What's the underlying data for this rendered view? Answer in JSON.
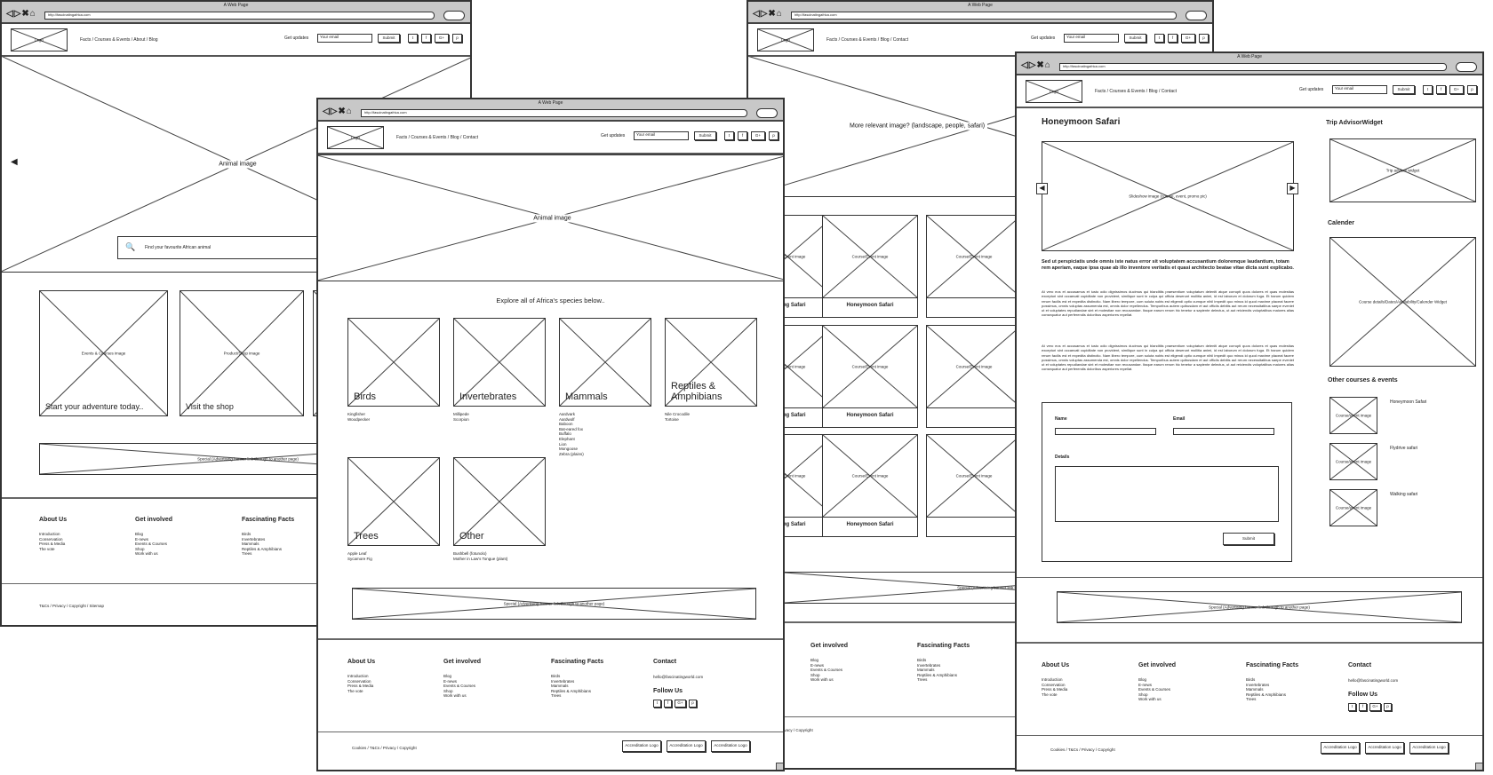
{
  "browser": {
    "title": "A Web Page",
    "url": "http://fascinatingafrica.com",
    "get_updates": "Get updates",
    "email_placeholder": "Your email",
    "submit": "Submit",
    "logo": "Logo",
    "social": [
      "t",
      "f",
      "G+",
      "p"
    ]
  },
  "footer": {
    "about": {
      "heading": "About Us",
      "items": [
        "Introduction",
        "Conservation",
        "Press & Media",
        "The vote"
      ]
    },
    "involved": {
      "heading": "Get involved",
      "items": [
        "Blog",
        "E-news",
        "Events & Courses",
        "Shop",
        "Work with us"
      ]
    },
    "facts": {
      "heading": "Fascinating Facts",
      "items": [
        "Birds",
        "Invertebrates",
        "Mammals",
        "Reptiles & Amphibians",
        "Trees"
      ]
    },
    "contact": {
      "heading": "Contact",
      "email": "hello@fascinatingworld.com",
      "follow": "Follow Us"
    },
    "bottom_links": "Cookies / T&Cs / Privacy / Copyright",
    "accreditation": "Accreditation Logo",
    "banner": "Special (Advertising banner link through to another page)"
  },
  "home": {
    "nav": "Facts / Courses & Events / About / Blog",
    "hero": "Animal image",
    "search_placeholder": "Find your favourite African animal",
    "cards": [
      {
        "image": "Events & Courses image",
        "caption": "Start your adventure today.."
      },
      {
        "image": "Product/Shop image",
        "caption": "Visit the shop"
      }
    ],
    "bottom_links": "T&Cs / Privacy / Copyright / Sitemap"
  },
  "species": {
    "nav": "Facts / Courses & Events / Blog / Contact",
    "hero": "Animal image",
    "intro": "Explore all of Africa's species below..",
    "categories": [
      {
        "name": "Birds",
        "items": [
          "Kingfisher",
          "Woodpecker"
        ]
      },
      {
        "name": "Invertebrates",
        "items": [
          "Millipede",
          "Scorpion"
        ]
      },
      {
        "name": "Mammals",
        "items": [
          "Aardvark",
          "Aardwolf",
          "Baboon",
          "Bat-eared fox",
          "Buffalo",
          "Elephant",
          "Lion",
          "Mongoose",
          "Zebra (plains)"
        ]
      },
      {
        "name": "Reptiles & Amphibians",
        "items": [
          "Nile Crocodile",
          "Tortoise"
        ]
      },
      {
        "name": "Trees",
        "items": [
          "Apple Leaf",
          "Sycamore Fig"
        ]
      },
      {
        "name": "Other",
        "items": [
          "Bushbell (fotunolo)",
          "Mother in Law's Tongue (plant)"
        ]
      }
    ]
  },
  "courses": {
    "nav": "Facts / Courses & Events / Blog / Contact",
    "hero": "More relevant image? (landscape, people, safari)",
    "card_image": "Course/Event image",
    "rows": [
      [
        "Walking Safari",
        "Honeymoon Safari"
      ],
      [
        "Walking Safari",
        "Honeymoon Safari"
      ],
      [
        "Walking Safari",
        "Honeymoon Safari"
      ]
    ]
  },
  "detail": {
    "nav": "Facts / Courses & Events / Blog / Contact",
    "title": "Honeymoon Safari",
    "slideshow": "Slideshow image (course, event, promo pic)",
    "lead": "Sed ut perspiciatis unde omnis iste natus error sit voluptatem accusantium doloremque laudantium, totam rem aperiam, eaque ipsa quae ab illo inventore veritatis et quasi architecto beatae vitae dicta sunt explicabo.",
    "paragraphs": [
      "At vero eos et accusamus et iusto odio dignissimos ducimus qui blanditiis praesentium voluptatum deleniti atque corrupti quos dolores et quas molestias excepturi sint occaecati cupiditate non provident, similique sunt in culpa qui officia deserunt mollitia animi, id est laborum et dolorum fuga. Et harum quidem rerum facilis est et expedita distinctio. Nam libero tempore, cum soluta nobis est eligendi optio cumque nihil impedit quo minus id quod maxime placeat facere possimus, omnis voluptas assumenda est, omnis dolor repellendus. Temporibus autem quibusdam et aut officiis debitis aut rerum necessitatibus saepe eveniet ut et voluptates repudiandae sint et molestiae non recusandae. Itaque earum rerum hic tenetur a sapiente delectus, ut aut reiciendis voluptatibus maiores alias consequatur aut perferendis doloribus asperiores repellat.",
      "At vero eos et accusamus et iusto odio dignissimos ducimus qui blanditiis praesentium voluptatum deleniti atque corrupti quos dolores et quas molestias excepturi sint occaecati cupiditate non provident, similique sunt in culpa qui officia deserunt mollitia animi, id est laborum et dolorum fuga. Et harum quidem rerum facilis est et expedita distinctio. Nam libero tempore, cum soluta nobis est eligendi optio cumque nihil impedit quo minus id quod maxime placeat facere possimus, omnis voluptas assumenda est, omnis dolor repellendus. Temporibus autem quibusdam et aut officiis debitis aut rerum necessitatibus saepe eveniet ut et voluptates repudiandae sint et molestiae non recusandae. Itaque earum rerum hic tenetur a sapiente delectus, ut aut reiciendis voluptatibus maiores alias consequatur aut perferendis doloribus asperiores repellat."
    ],
    "form": {
      "name_label": "Name",
      "email_label": "Email",
      "details_label": "Details",
      "submit": "Submit"
    },
    "sidebar": {
      "tripadvisor_heading": "Trip AdvisorWidget",
      "tripadvisor_widget": "Trip advisor widget",
      "calendar_heading": "Calender",
      "calendar_widget": "Course details/Dates/Availability/Calender Widget",
      "other_heading": "Other courses & events",
      "other_image": "Course/event image",
      "other": [
        "Honeymoon Safari",
        "Flydrive safari",
        "Walking safari"
      ]
    }
  }
}
